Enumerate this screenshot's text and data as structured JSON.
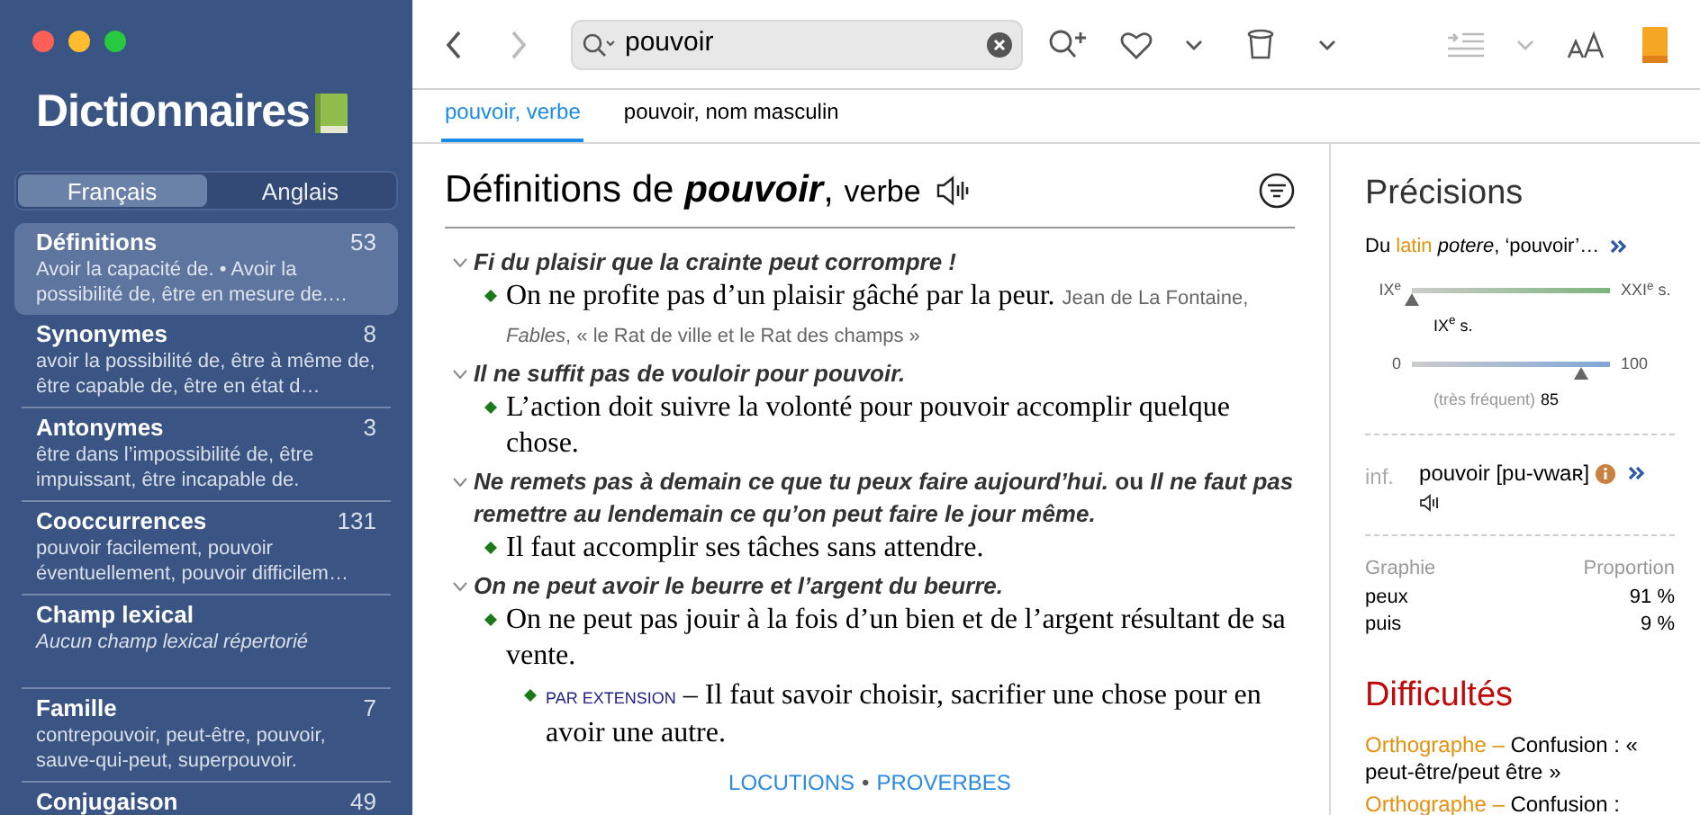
{
  "sidebar": {
    "title": "Dictionnaires",
    "language_tabs": [
      {
        "label": "Français",
        "selected": true
      },
      {
        "label": "Anglais",
        "selected": false
      }
    ],
    "items": [
      {
        "kind": "list",
        "title": "Définitions",
        "count": "53",
        "summary": "Avoir la capacité de. • Avoir la possibilité de, être en mesure de.…",
        "selected": true
      },
      {
        "kind": "list",
        "title": "Synonymes",
        "count": "8",
        "summary": "avoir la possibilité de, être à même de, être capable de, être en état d…",
        "selected": false
      },
      {
        "kind": "list",
        "title": "Antonymes",
        "count": "3",
        "summary": "être dans l’impossibilité de, être impuissant, être incapable de.",
        "selected": false
      },
      {
        "kind": "list",
        "title": "Cooccurrences",
        "count": "131",
        "summary": "pouvoir facilement, pouvoir éventuellement, pouvoir difficilem…",
        "selected": false
      },
      {
        "kind": "empty",
        "title": "Champ lexical",
        "summary": "Aucun champ lexical répertorié",
        "selected": false
      },
      {
        "kind": "list",
        "title": "Famille",
        "count": "7",
        "summary": "contrepouvoir, peut-être, pouvoir, sauve-qui-peut, superpouvoir.",
        "selected": false
      },
      {
        "kind": "list",
        "title": "Conjugaison",
        "count": "49",
        "selected": false
      }
    ]
  },
  "toolbar": {
    "search": {
      "value": "pouvoir"
    }
  },
  "entry_tabs": [
    {
      "label": "pouvoir, verbe",
      "selected": true
    },
    {
      "label": "pouvoir, nom masculin",
      "selected": false
    }
  ],
  "article": {
    "heading": "Définitions de **pouvoir**,",
    "part_of_speech": "verbe",
    "senses": [
      {
        "expression": "*Fi du plaisir que la crainte peut corrompre !*",
        "expanded": true,
        "children": [
          {
            "text": "On ne profite pas d’un plaisir gâché par la peur.",
            "source": "Jean de La Fontaine, *Fables*, « le Rat de ville et le Rat des champs »"
          }
        ]
      },
      {
        "expression": "*Il ne suffit pas de vouloir pour pouvoir.*",
        "expanded": true,
        "children": [
          {
            "text": "L’action doit suivre la volonté pour pouvoir accomplir quelque chose."
          }
        ]
      },
      {
        "expression": "*Ne remets pas à demain ce que tu peux faire aujourd’hui.* ou *Il ne faut pas remettre au lendemain ce qu’on peut faire le jour même.*",
        "expanded": true,
        "children": [
          {
            "text": "Il faut accomplir ses tâches sans attendre."
          }
        ]
      },
      {
        "expression": "*On ne peut avoir le beurre et l’argent du beurre.*",
        "expanded": true,
        "children": [
          {
            "text": "On ne peut pas jouir à la fois d’un bien et de l’argent résultant de sa vente.",
            "children": [
              {
                "label": "PAR EXTENSION",
                "text": "– Il faut savoir choisir, sacrifier une chose pour en avoir une autre."
              }
            ]
          }
        ]
      }
    ],
    "links": [
      "LOCUTIONS",
      "PROVERBES"
    ],
    "link_separator": "•"
  },
  "precisions": {
    "title": "Précisions",
    "etymology_prefix": "Du",
    "etymology_language": "latin",
    "etymology_rest": "*potere*, ‘pouvoir’…",
    "period": {
      "start": "IX$^{e}$",
      "end": "XXI$^{e}$ s.",
      "marker": "IX$^{e}$ s.",
      "level": 0
    },
    "frequency": {
      "min": "0",
      "max": "100",
      "label": "(très fréquent)",
      "value": "85",
      "level": 0.85
    },
    "pronunciation": {
      "label": "inf.",
      "text": "pouvoir [pu-vwaʀ]"
    },
    "spelling": {
      "columns": [
        "Graphie",
        "Proportion"
      ],
      "rows": [
        [
          "peux",
          "91 %"
        ],
        [
          "puis",
          "9 %"
        ]
      ]
    }
  },
  "difficulties": {
    "title": "Difficultés",
    "items": [
      {
        "category": "Orthographe –",
        "text": "Confusion : « peut-être/peut être »"
      },
      {
        "category": "Orthographe –",
        "text": "Confusion :"
      }
    ]
  }
}
